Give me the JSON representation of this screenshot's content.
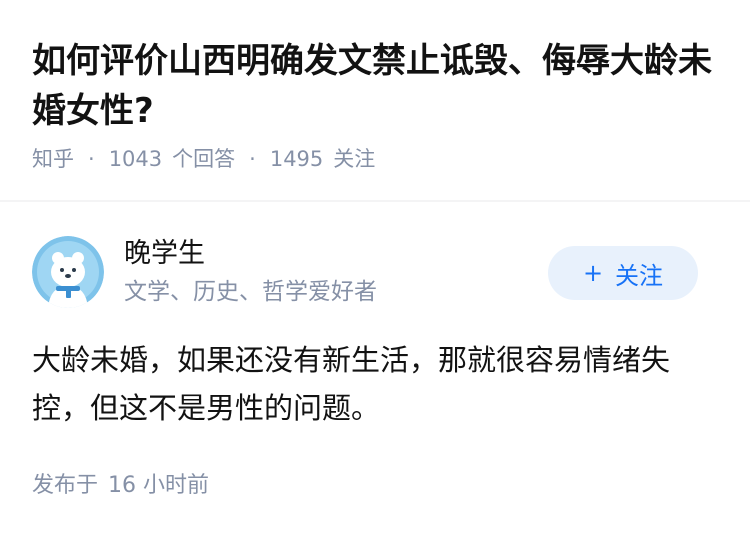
{
  "question": {
    "title": "如何评价山西明确发文禁止诋毁、侮辱大龄未婚女性?",
    "source": "知乎",
    "separator": "·",
    "answer_count": "1043",
    "answer_label": "个回答",
    "follower_count": "1495",
    "follower_label": "关注"
  },
  "answer": {
    "author": {
      "name": "晚学生",
      "bio": "文学、历史、哲学爱好者",
      "avatar_icon": "polar-bear-avatar-icon"
    },
    "follow_button": {
      "plus": "+",
      "label": "关注"
    },
    "content": "大龄未婚，如果还没有新生活，那就很容易情绪失控，但这不是男性的问题。",
    "published_prefix": "发布于",
    "published_time": "16 小时前"
  },
  "colors": {
    "text": "#121212",
    "meta": "#8590a6",
    "accent": "#1772f6",
    "button_bg": "#e8f1fc",
    "avatar_bg": "#7ec3ea"
  }
}
